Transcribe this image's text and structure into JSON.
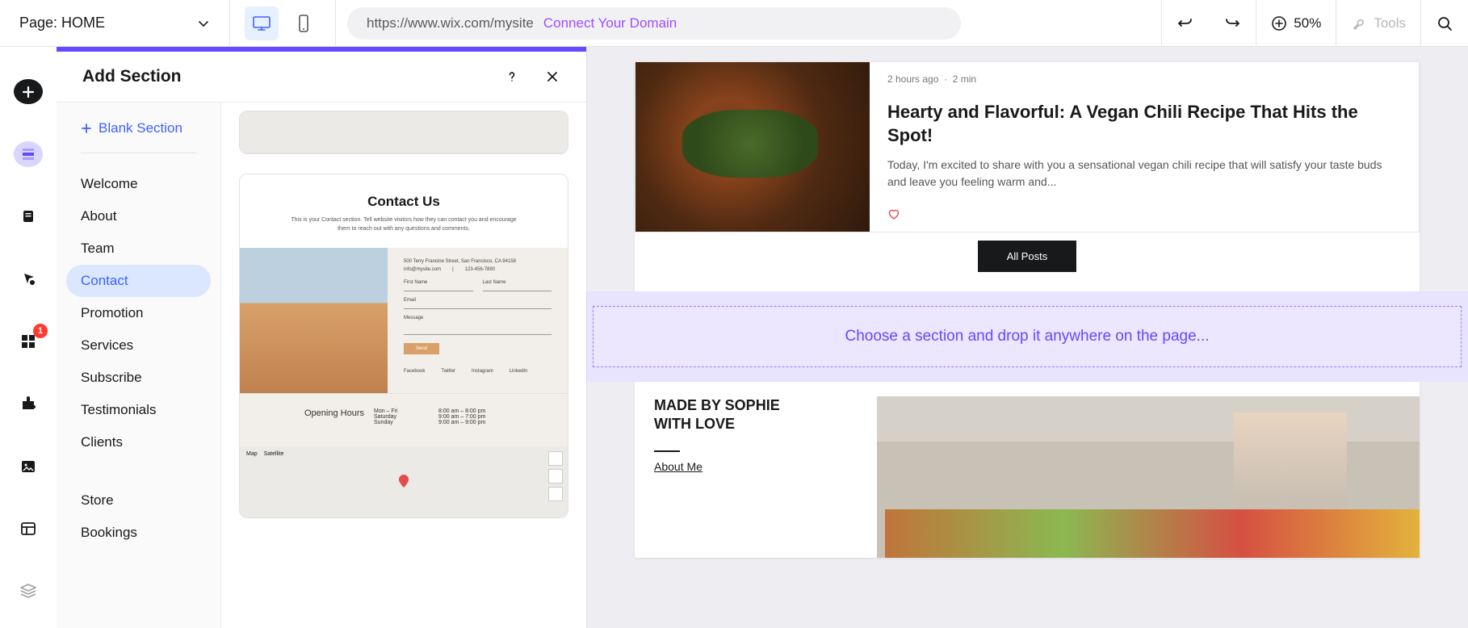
{
  "topbar": {
    "page_label": "Page: HOME",
    "url": "https://www.wix.com/mysite",
    "connect_domain": "Connect Your Domain",
    "zoom": "50%",
    "tools": "Tools"
  },
  "rail": {
    "badge": "1"
  },
  "panel": {
    "title": "Add Section",
    "blank_section": "Blank Section",
    "categories": [
      "Welcome",
      "About",
      "Team",
      "Contact",
      "Promotion",
      "Services",
      "Subscribe",
      "Testimonials",
      "Clients"
    ],
    "active_category": "Contact",
    "categories_extra": [
      "Store",
      "Bookings"
    ],
    "preview": {
      "contact_title": "Contact Us",
      "contact_sub": "This is your Contact section. Tell website visitors how they can contact you and encourage them to reach out with any questions and comments.",
      "address": "500 Terry Francine Street, San Francisco, CA 94158",
      "email": "info@mysite.com",
      "phone": "123-456-7890",
      "fields": {
        "first": "First Name",
        "last": "Last Name",
        "email": "Email",
        "message": "Message"
      },
      "send": "Send",
      "socials": [
        "Facebook",
        "Twitter",
        "Instagram",
        "LinkedIn"
      ],
      "hours_label": "Opening Hours",
      "hours": [
        {
          "d": "Mon – Fri",
          "t": "8:00 am – 8:00 pm"
        },
        {
          "d": "Saturday",
          "t": "9:00 am – 7:00 pm"
        },
        {
          "d": "Sunday",
          "t": "9:00 am – 9:00 pm"
        }
      ],
      "map_tabs": [
        "Map",
        "Satellite"
      ]
    }
  },
  "stage": {
    "post": {
      "meta_time": "2 hours ago",
      "meta_sep": "·",
      "meta_read": "2 min",
      "title": "Hearty and Flavorful: A Vegan Chili Recipe That Hits the Spot!",
      "excerpt": "Today, I'm excited to share with you a sensational vegan chili recipe that will satisfy your taste buds and leave you feeling warm and..."
    },
    "all_posts": "All Posts",
    "dropzone": "Choose a section and drop it anywhere on the page...",
    "about": {
      "line1": "MADE BY SOPHIE",
      "line2": "WITH LOVE",
      "link": "About Me"
    }
  }
}
